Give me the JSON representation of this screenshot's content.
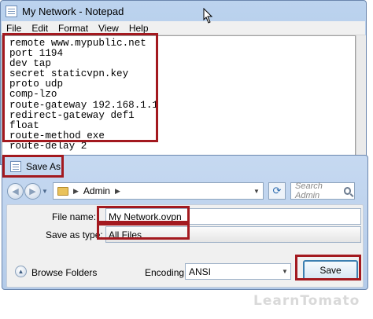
{
  "notepad": {
    "title": "My Network - Notepad",
    "menu": [
      "File",
      "Edit",
      "Format",
      "View",
      "Help"
    ],
    "content": "remote www.mypublic.net\nport 1194\ndev tap\nsecret staticvpn.key\nproto udp\ncomp-lzo\nroute-gateway 192.168.1.1\nredirect-gateway def1\nfloat\nroute-method exe\nroute-delay 2"
  },
  "dialog": {
    "title": "Save As",
    "address": "Admin",
    "search_placeholder": "Search Admin",
    "file_name_label": "File name:",
    "file_name_value": "My Network.ovpn",
    "save_type_label": "Save as type:",
    "save_type_value": "All Files",
    "browse_label": "Browse Folders",
    "encoding_label": "Encoding:",
    "encoding_value": "ANSI",
    "save_label": "Save"
  },
  "icons": {
    "back": "back-arrow-icon",
    "forward": "forward-arrow-icon",
    "refresh": "refresh-icon",
    "search": "search-icon",
    "expand": "chevron-up-icon"
  },
  "colors": {
    "highlight": "#a3191f",
    "window_frame": "#bcd3ee"
  },
  "watermark": "LearnTomato"
}
